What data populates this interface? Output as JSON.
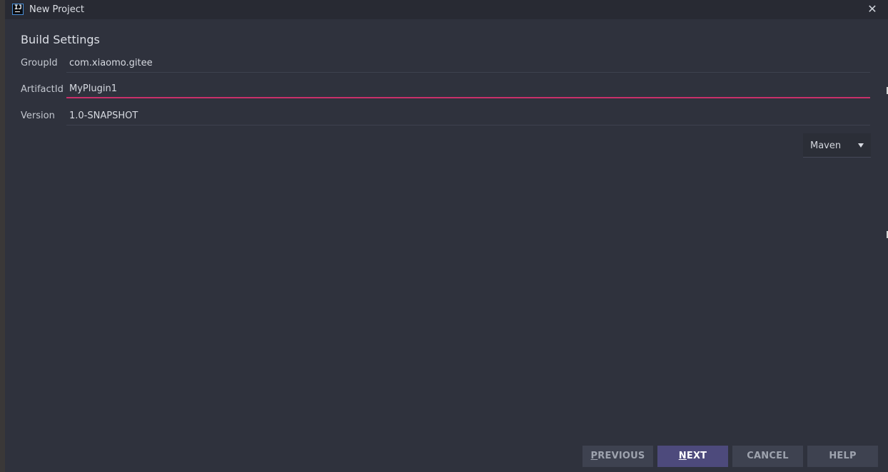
{
  "window": {
    "title": "New Project",
    "icon_text": "IJ"
  },
  "section": {
    "title": "Build Settings"
  },
  "fields": {
    "group_id": {
      "label": "GroupId",
      "value": "com.xiaomo.gitee"
    },
    "artifact_id": {
      "label": "ArtifactId",
      "value": "MyPlugin1"
    },
    "version": {
      "label": "Version",
      "value": "1.0-SNAPSHOT"
    }
  },
  "build_tool": {
    "selected": "Maven"
  },
  "buttons": {
    "previous": {
      "first": "P",
      "rest": "REVIOUS"
    },
    "next": {
      "first": "N",
      "rest": "EXT"
    },
    "cancel": "CANCEL",
    "help": "HELP"
  },
  "colors": {
    "background": "#2f323d",
    "titlebar": "#282a33",
    "focus_underline": "#c9306a",
    "primary_button": "#4d4a7c",
    "button": "#3e4250"
  }
}
